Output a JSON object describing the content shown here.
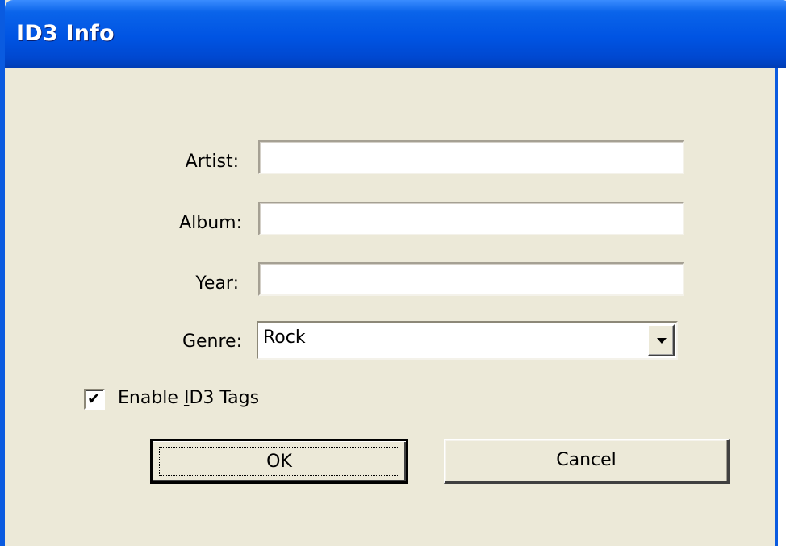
{
  "window": {
    "title": "ID3 Info"
  },
  "form": {
    "artist": {
      "label": "Artist:",
      "value": ""
    },
    "album": {
      "label": "Album:",
      "value": ""
    },
    "year": {
      "label": "Year:",
      "value": ""
    },
    "genre": {
      "label": "Genre:",
      "value": "Rock"
    }
  },
  "options": {
    "enable_id3": {
      "label_before": "Enable ",
      "label_accel": "I",
      "label_after": "D3 Tags",
      "checked": true,
      "check_glyph": "✔"
    }
  },
  "buttons": {
    "ok": "OK",
    "cancel": "Cancel"
  },
  "icons": {
    "combo_arrow": "chevron-down-icon",
    "checkmark": "checkmark-icon"
  },
  "colors": {
    "titlebar": "#0054E3",
    "dialog_face": "#ECE9D8",
    "field_bg": "#FFFFFF"
  }
}
